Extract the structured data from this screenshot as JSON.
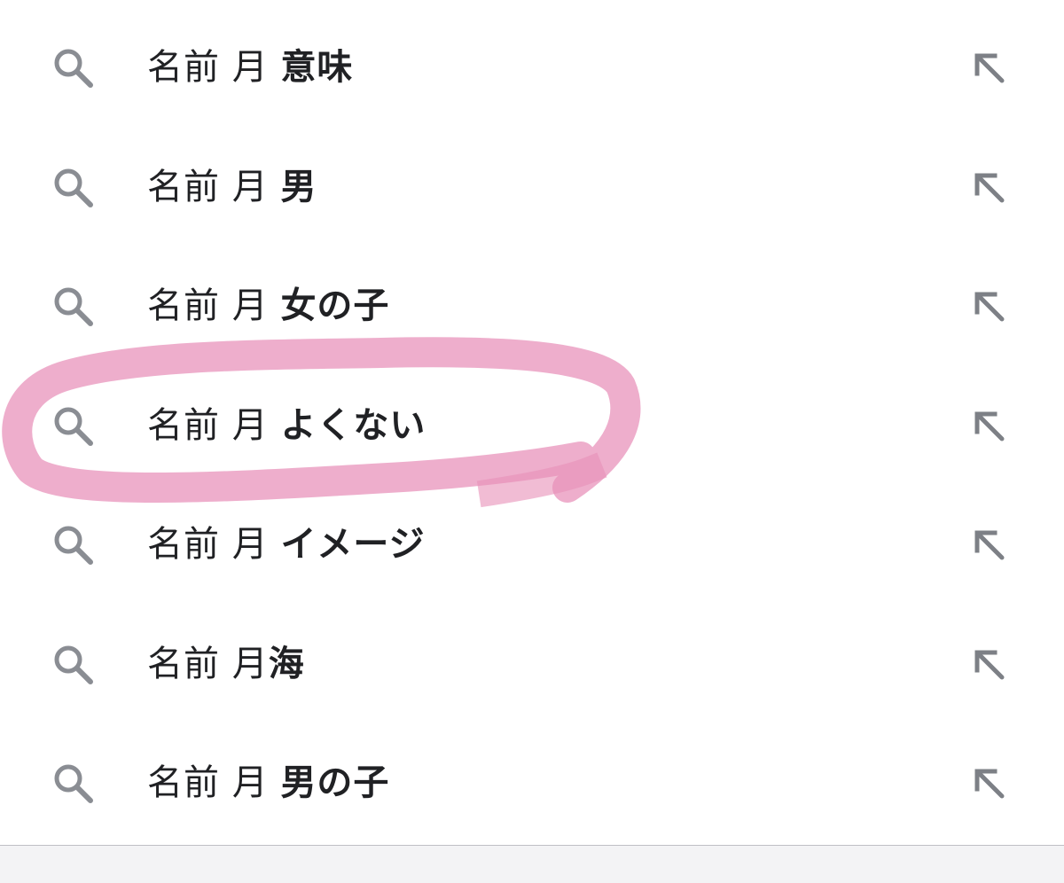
{
  "suggestions": [
    {
      "prefix": "名前 月 ",
      "suffix": "意味"
    },
    {
      "prefix": "名前 月 ",
      "suffix": "男"
    },
    {
      "prefix": "名前 月 ",
      "suffix": "女の子"
    },
    {
      "prefix": "名前 月 ",
      "suffix": "よくない"
    },
    {
      "prefix": "名前 月 ",
      "suffix": "イメージ"
    },
    {
      "prefix": "名前 月",
      "suffix": "海"
    },
    {
      "prefix": "名前 月 ",
      "suffix": "男の子"
    }
  ],
  "icons": {
    "search": "search-icon",
    "fill": "arrow-up-left-icon"
  },
  "colors": {
    "text": "#202124",
    "icon": "#8a8d93",
    "highlight": "#e88fb8",
    "bottom_bar": "#f3f3f5"
  }
}
